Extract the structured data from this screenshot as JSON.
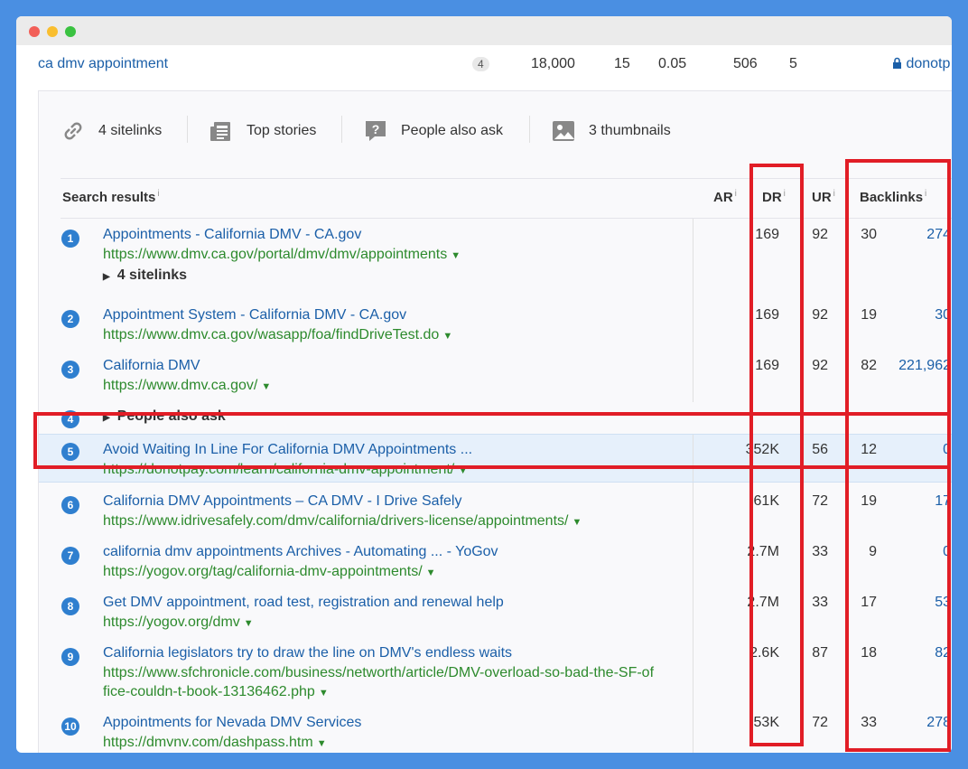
{
  "keyword_row": {
    "keyword": "ca dmv appointment",
    "pill": "4",
    "volume": "18,000",
    "kd": "15",
    "cpc": "0.05",
    "traffic": "506",
    "clicks": "5",
    "domain": "donotp"
  },
  "features": [
    {
      "icon": "link-icon",
      "label": "4 sitelinks"
    },
    {
      "icon": "newspaper-icon",
      "label": "Top stories"
    },
    {
      "icon": "question-icon",
      "label": "People also ask"
    },
    {
      "icon": "image-icon",
      "label": "3 thumbnails"
    }
  ],
  "headers": {
    "search_results": "Search results",
    "ar": "AR",
    "dr": "DR",
    "ur": "UR",
    "backlinks": "Backlinks",
    "info": "i"
  },
  "results": [
    {
      "n": "1",
      "title": "Appointments - California DMV - CA.gov",
      "url": "https://www.dmv.ca.gov/portal/dmv/dmv/appointments",
      "ar": "169",
      "dr": "92",
      "ur": "30",
      "bl": "274",
      "sub": "4 sitelinks"
    },
    {
      "n": "2",
      "title": "Appointment System - California DMV - CA.gov",
      "url": "https://www.dmv.ca.gov/wasapp/foa/findDriveTest.do",
      "ar": "169",
      "dr": "92",
      "ur": "19",
      "bl": "30"
    },
    {
      "n": "3",
      "title": "California DMV",
      "url": "https://www.dmv.ca.gov/",
      "ar": "169",
      "dr": "92",
      "ur": "82",
      "bl": "221,962"
    },
    {
      "n": "4",
      "sub": "People also ask"
    },
    {
      "n": "5",
      "title": "Avoid Waiting In Line For California DMV Appointments ...",
      "url": "https://donotpay.com/learn/california-dmv-appointment/",
      "ar": "352K",
      "dr": "56",
      "ur": "12",
      "bl": "0"
    },
    {
      "n": "6",
      "title": "California DMV Appointments – CA DMV - I Drive Safely",
      "url": "https://www.idrivesafely.com/dmv/california/drivers-license/appointments/",
      "ar": "61K",
      "dr": "72",
      "ur": "19",
      "bl": "17"
    },
    {
      "n": "7",
      "title": "california dmv appointments Archives - Automating ... - YoGov",
      "url": "https://yogov.org/tag/california-dmv-appointments/",
      "ar": "2.7M",
      "dr": "33",
      "ur": "9",
      "bl": "0"
    },
    {
      "n": "8",
      "title": "Get DMV appointment, road test, registration and renewal help",
      "url": "https://yogov.org/dmv",
      "ar": "2.7M",
      "dr": "33",
      "ur": "17",
      "bl": "53"
    },
    {
      "n": "9",
      "title": "California legislators try to draw the line on DMV's endless waits",
      "url_lines": [
        "https://www.sfchronicle.com/business/networth/article/DMV-overload-so-bad-the-SF-of",
        "fice-couldn-t-book-13136462.php"
      ],
      "ar": "2.6K",
      "dr": "87",
      "ur": "18",
      "bl": "82"
    },
    {
      "n": "10",
      "title": "Appointments for Nevada DMV Services",
      "url": "https://dmvnv.com/dashpass.htm",
      "ar": "53K",
      "dr": "72",
      "ur": "33",
      "bl": "278"
    }
  ],
  "colors": {
    "accent": "#1b5fa8",
    "url_green": "#2d8a2d",
    "highlight": "#e11d26",
    "badge": "#2f7fcf"
  }
}
